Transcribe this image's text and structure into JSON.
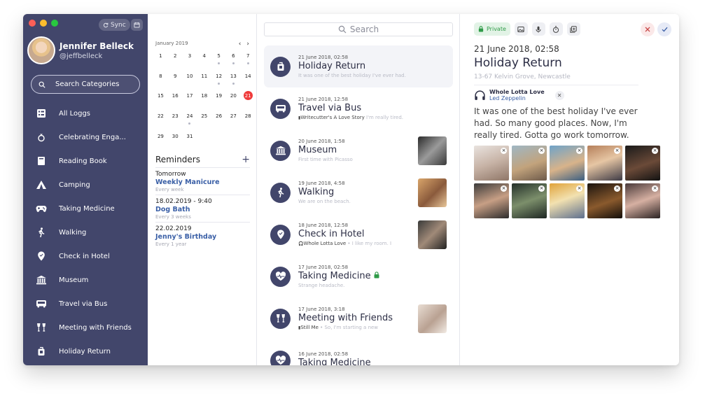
{
  "sidebar": {
    "sync_label": "Sync",
    "user_name": "Jennifer Belleck",
    "user_handle": "@jeffbelleck",
    "search_label": "Search Categories",
    "items": [
      {
        "label": "All Loggs",
        "icon": "list-icon"
      },
      {
        "label": "Celebrating Enga...",
        "icon": "ring-icon"
      },
      {
        "label": "Reading Book",
        "icon": "book-icon"
      },
      {
        "label": "Camping",
        "icon": "tent-icon"
      },
      {
        "label": "Taking Medicine",
        "icon": "gamepad-icon"
      },
      {
        "label": "Walking",
        "icon": "walking-icon"
      },
      {
        "label": "Check in Hotel",
        "icon": "location-pin-icon"
      },
      {
        "label": "Museum",
        "icon": "museum-icon"
      },
      {
        "label": "Travel via Bus",
        "icon": "bus-icon"
      },
      {
        "label": "Meeting with Friends",
        "icon": "cheers-icon"
      },
      {
        "label": "Holiday Return",
        "icon": "luggage-icon"
      }
    ]
  },
  "calendar": {
    "month_label": "January 2019",
    "prev": "‹",
    "next": "›",
    "days": [
      {
        "d": "1"
      },
      {
        "d": "2"
      },
      {
        "d": "3"
      },
      {
        "d": "4"
      },
      {
        "d": "5",
        "dot": true
      },
      {
        "d": "6",
        "dot": true
      },
      {
        "d": "7",
        "dot": true
      },
      {
        "d": "8"
      },
      {
        "d": "9"
      },
      {
        "d": "10"
      },
      {
        "d": "11"
      },
      {
        "d": "12",
        "dot": true
      },
      {
        "d": "13",
        "dot": true
      },
      {
        "d": "14"
      },
      {
        "d": "15"
      },
      {
        "d": "16"
      },
      {
        "d": "17"
      },
      {
        "d": "18"
      },
      {
        "d": "19"
      },
      {
        "d": "20"
      },
      {
        "d": "21",
        "today": true
      },
      {
        "d": "22"
      },
      {
        "d": "23"
      },
      {
        "d": "24",
        "dot": true
      },
      {
        "d": "25"
      },
      {
        "d": "26"
      },
      {
        "d": "27"
      },
      {
        "d": "28"
      },
      {
        "d": "29"
      },
      {
        "d": "30"
      },
      {
        "d": "31"
      }
    ]
  },
  "reminders": {
    "title": "Reminders",
    "add": "+",
    "items": [
      {
        "date": "Tomorrow",
        "title": "Weekly Manicure",
        "freq": "Every week"
      },
      {
        "date": "18.02.2019 - 9:40",
        "title": "Dog Bath",
        "freq": "Every 3 weeks"
      },
      {
        "date": "22.02.2019",
        "title": "Jenny's Birthday",
        "freq": "Every 1 year"
      }
    ]
  },
  "feed": {
    "search_placeholder": "Search",
    "entries": [
      {
        "date": "21 June 2018, 02:58",
        "title": "Holiday Return",
        "sub_tag": "",
        "sub": "It was one of the best holiday I've ever had.",
        "icon": "luggage-icon",
        "thumb": "",
        "active": true
      },
      {
        "date": "21 June 2018, 12:58",
        "title": "Travel via Bus",
        "sub_tag": "Writecutter's A Love Story",
        "sub": " I'm really tired.",
        "icon": "bus-icon",
        "thumb": ""
      },
      {
        "date": "20 June 2018, 1:58",
        "title": "Museum",
        "sub_tag": "",
        "sub": "First time with Picasso",
        "icon": "museum-icon",
        "thumb": "linear-gradient(135deg,#2b2b2b,#9a9a9a 50%,#3a3a3a)"
      },
      {
        "date": "19 June 2018, 4:58",
        "title": "Walking",
        "sub_tag": "",
        "sub": "We are on the beach.",
        "icon": "walking-icon",
        "thumb": "linear-gradient(135deg,#d9a56a,#8a5a3c 55%,#e8c79a)"
      },
      {
        "date": "18 June 2018, 12:58",
        "title": "Check in Hotel",
        "sub_tag": "Whole Lotta Love",
        "sub": " • I like my room. I",
        "icon": "location-pin-icon",
        "thumb": "linear-gradient(135deg,#3a3a3a,#a08a78 50%,#222)"
      },
      {
        "date": "17 June 2018, 02:58",
        "title": "Taking Medicine",
        "sub_tag": "",
        "sub": "Strange headache.",
        "icon": "heart-pulse-icon",
        "thumb": "",
        "locked": true
      },
      {
        "date": "17 June 2018, 3:18",
        "title": "Meeting with Friends",
        "sub_tag": "Still Me",
        "sub": " • So, I'm starting a new",
        "icon": "cheers-icon",
        "thumb": "linear-gradient(135deg,#e8ddd3,#b9a192 55%,#f2ebe4)"
      },
      {
        "date": "16 June 2018, 02:58",
        "title": "Taking Medicine",
        "sub_tag": "",
        "sub": "",
        "icon": "heart-pulse-icon",
        "thumb": ""
      }
    ]
  },
  "detail": {
    "private_label": "Private",
    "date": "21 June 2018, 02:58",
    "title": "Holiday Return",
    "location": "13-67 Kelvin Grove, Newcastle",
    "song_title": "Whole Lotta Love",
    "song_artist": "Led Zeppelin",
    "song_remove": "✕",
    "text": "It was one of the best holiday I've ever had. So many good places. Now, I'm really tired. Gotta go work tomorrow.",
    "photo_remove": "×",
    "photos": [
      "linear-gradient(160deg,#e9e3df,#c7b3a6 50%,#8f7667)",
      "linear-gradient(160deg,#9fb7c4,#c2a37c 55%,#6d5a4a)",
      "linear-gradient(160deg,#6ea3c9,#d8b38a 55%,#3a5f82)",
      "linear-gradient(160deg,#b57f5a,#e6c6a4 45%,#3d3a45)",
      "linear-gradient(160deg,#1a1a1a,#6b4a38 55%,#121212)",
      "linear-gradient(160deg,#3b3b3b,#c79f85 50%,#2b2b2b)",
      "linear-gradient(160deg,#24302a,#7c8f6b 50%,#1d2622)",
      "linear-gradient(160deg,#e0a33a,#f2e1b0 45%,#5d6f8e)",
      "linear-gradient(160deg,#1b140f,#8a5a2d 55%,#120d09)",
      "linear-gradient(160deg,#4a3a3a,#d6b0a2 50%,#2a2222)"
    ]
  },
  "colors": {
    "sidebar": "#42466b",
    "accent": "#3a5fa6",
    "today": "#ef3b3b",
    "private": "#2f9b48"
  }
}
